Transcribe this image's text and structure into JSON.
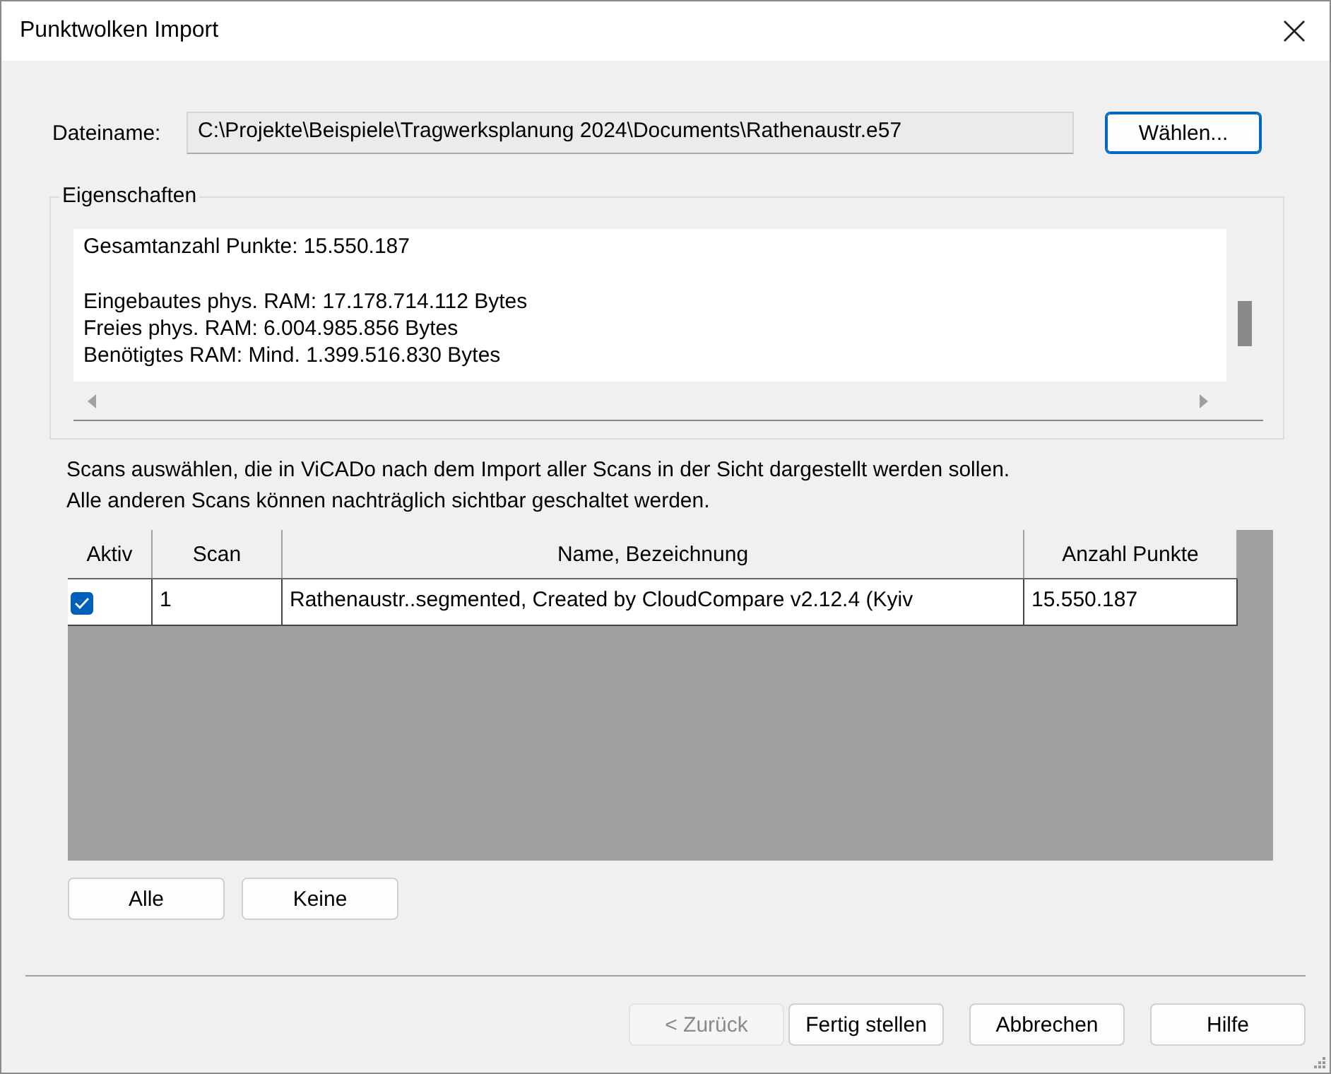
{
  "window": {
    "title": "Punktwolken Import"
  },
  "file": {
    "label": "Dateiname:",
    "value": "C:\\Projekte\\Beispiele\\Tragwerksplanung 2024\\Documents\\Rathenaustr.e57",
    "button": "Wählen..."
  },
  "properties": {
    "title": "Eigenschaften",
    "paragraphs": [
      [
        "Gesamtanzahl Punkte: 15.550.187"
      ],
      [
        "Eingebautes phys. RAM: 17.178.714.112 Bytes",
        "Freies phys. RAM: 6.004.985.856 Bytes",
        "Benötigtes RAM: Mind. 1.399.516.830 Bytes"
      ]
    ]
  },
  "instructions": [
    "Scans auswählen, die in ViCADo nach dem Import aller Scans in der Sicht dargestellt werden sollen.",
    "Alle anderen Scans können nachträglich sichtbar geschaltet werden."
  ],
  "table": {
    "columns": [
      "Aktiv",
      "Scan",
      "Name, Bezeichnung",
      "Anzahl Punkte"
    ],
    "rows": [
      {
        "checked": true,
        "scan": "1",
        "name": "Rathenaustr..segmented, Created by CloudCompare v2.12.4 (Kyiv",
        "points": "15.550.187"
      }
    ]
  },
  "selection_buttons": [
    "Alle",
    "Keine"
  ],
  "footer_buttons": [
    {
      "label": "< Zurück",
      "disabled": true
    },
    {
      "label": "Fertig stellen",
      "disabled": false
    },
    {
      "label": "Abbrechen",
      "disabled": false
    },
    {
      "label": "Hilfe",
      "disabled": false
    }
  ]
}
